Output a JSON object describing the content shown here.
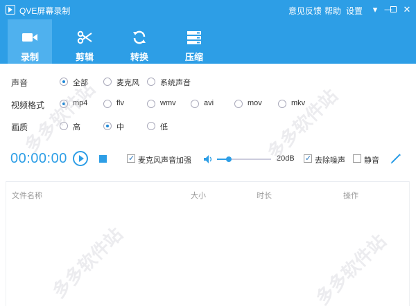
{
  "window": {
    "title": "QVE屏幕录制"
  },
  "header_links": {
    "feedback": "意见反馈",
    "help": "帮助",
    "settings": "设置"
  },
  "window_controls": {
    "menu": "▾",
    "minimize": "—",
    "maximize": "☐",
    "close": "✕"
  },
  "tabs": [
    {
      "label": "录制",
      "icon": "video-camera-icon",
      "active": true
    },
    {
      "label": "剪辑",
      "icon": "scissors-icon",
      "active": false
    },
    {
      "label": "转换",
      "icon": "convert-icon",
      "active": false
    },
    {
      "label": "压缩",
      "icon": "compress-icon",
      "active": false
    }
  ],
  "options": {
    "audio": {
      "label": "声音",
      "choices": [
        "全部",
        "麦克风",
        "系统声音"
      ],
      "selected": "全部"
    },
    "format": {
      "label": "视频格式",
      "choices": [
        "mp4",
        "flv",
        "wmv",
        "avi",
        "mov",
        "mkv"
      ],
      "selected": "mp4"
    },
    "quality": {
      "label": "画质",
      "choices": [
        "高",
        "中",
        "低"
      ],
      "selected": "中"
    }
  },
  "recorder": {
    "timer": "00:00:00",
    "mic_boost_label": "麦克风声音加强",
    "mic_boost": true,
    "volume_label": "20dB",
    "volume_level": 0.22,
    "denoise_label": "去除噪声",
    "denoise": true,
    "mute_label": "静音",
    "mute": false
  },
  "table": {
    "headers": [
      "文件名称",
      "大小",
      "时长",
      "操作"
    ]
  },
  "colors": {
    "accent": "#2d9ee6",
    "tab_active": "#4fb1ee"
  },
  "watermark": "多多软件站"
}
